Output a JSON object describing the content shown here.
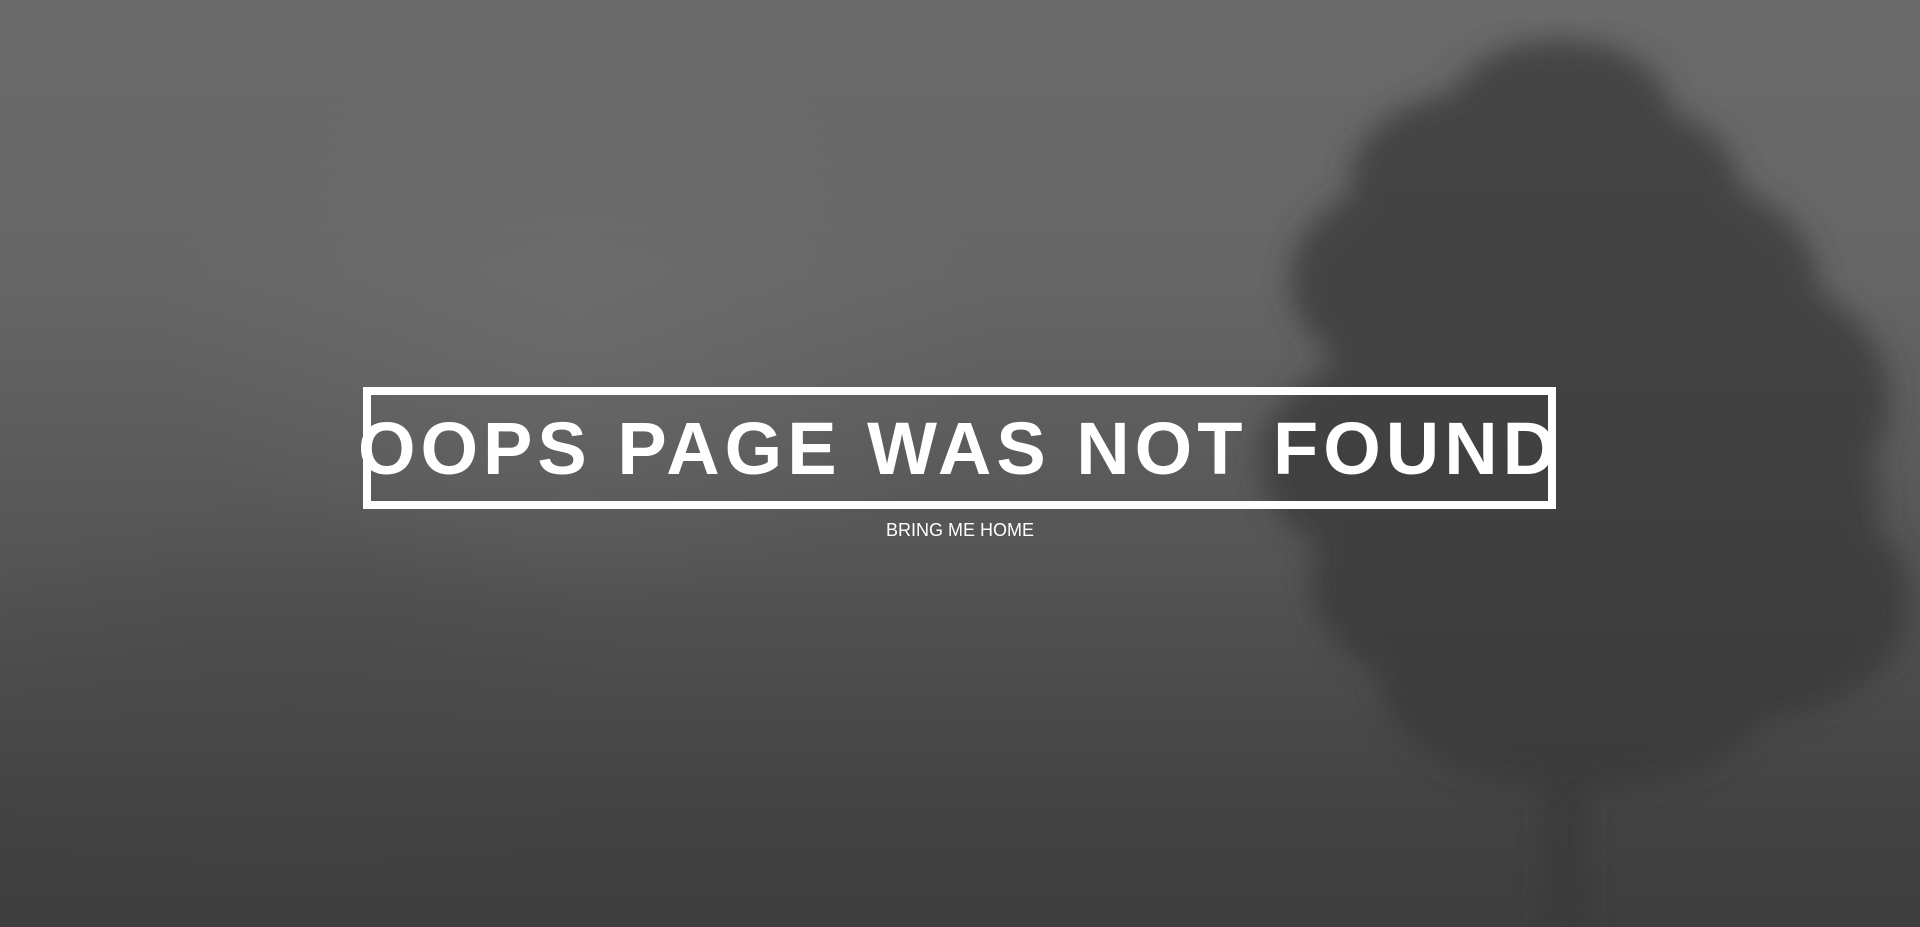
{
  "page": {
    "title": "OOPS PAGE WAS NOT FOUND",
    "home_link_label": "BRING ME HOME"
  },
  "colors": {
    "text": "#ffffff",
    "background": "#5a5a5a",
    "tree": "#363636"
  },
  "background_image": "foggy-tree-photo"
}
